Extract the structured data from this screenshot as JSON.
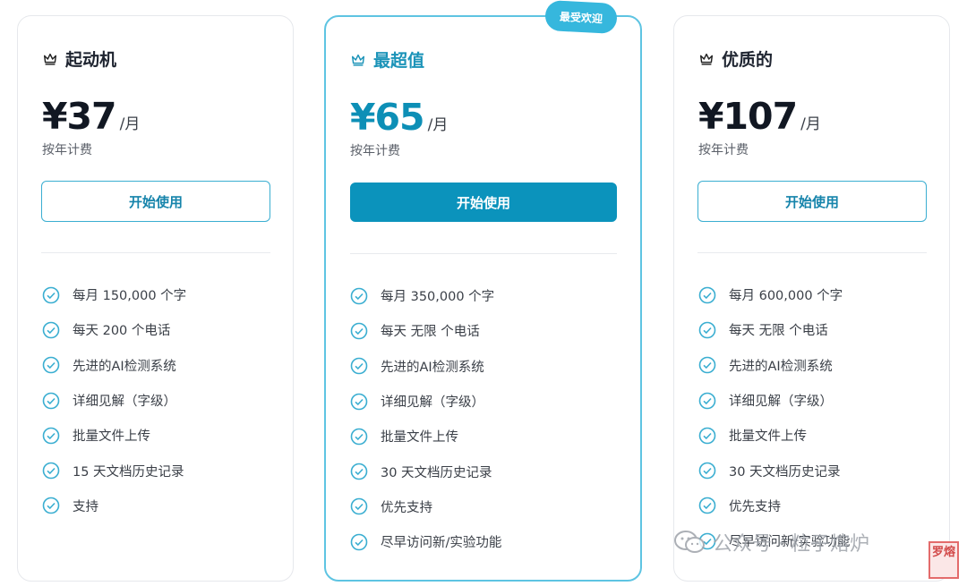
{
  "badge": "最受欢迎",
  "plans": [
    {
      "name": "起动机",
      "price": "¥37",
      "per": "/月",
      "billing": "按年计费",
      "cta": "开始使用",
      "features": [
        "每月 150,000 个字",
        "每天 200 个电话",
        "先进的AI检测系统",
        "详细见解（字级）",
        "批量文件上传",
        "15 天文档历史记录",
        "支持"
      ]
    },
    {
      "name": "最超值",
      "price": "¥65",
      "per": "/月",
      "billing": "按年计费",
      "cta": "开始使用",
      "features": [
        "每月 350,000 个字",
        "每天 无限 个电话",
        "先进的AI检测系统",
        "详细见解（字级）",
        "批量文件上传",
        "30 天文档历史记录",
        "优先支持",
        "尽早访问新/实验功能"
      ]
    },
    {
      "name": "优质的",
      "price": "¥107",
      "per": "/月",
      "billing": "按年计费",
      "cta": "开始使用",
      "features": [
        "每月 600,000 个字",
        "每天 无限 个电话",
        "先进的AI检测系统",
        "详细见解（字级）",
        "批量文件上传",
        "30 天文档历史记录",
        "优先支持",
        "尽早访问新/实验功能"
      ]
    }
  ],
  "watermark": {
    "text": "公众号 · 粒子熔炉",
    "seal": "罗熔"
  },
  "colors": {
    "accent": "#0b93bc",
    "featured_border": "#5ec4e2",
    "check": "#3aaed1"
  }
}
